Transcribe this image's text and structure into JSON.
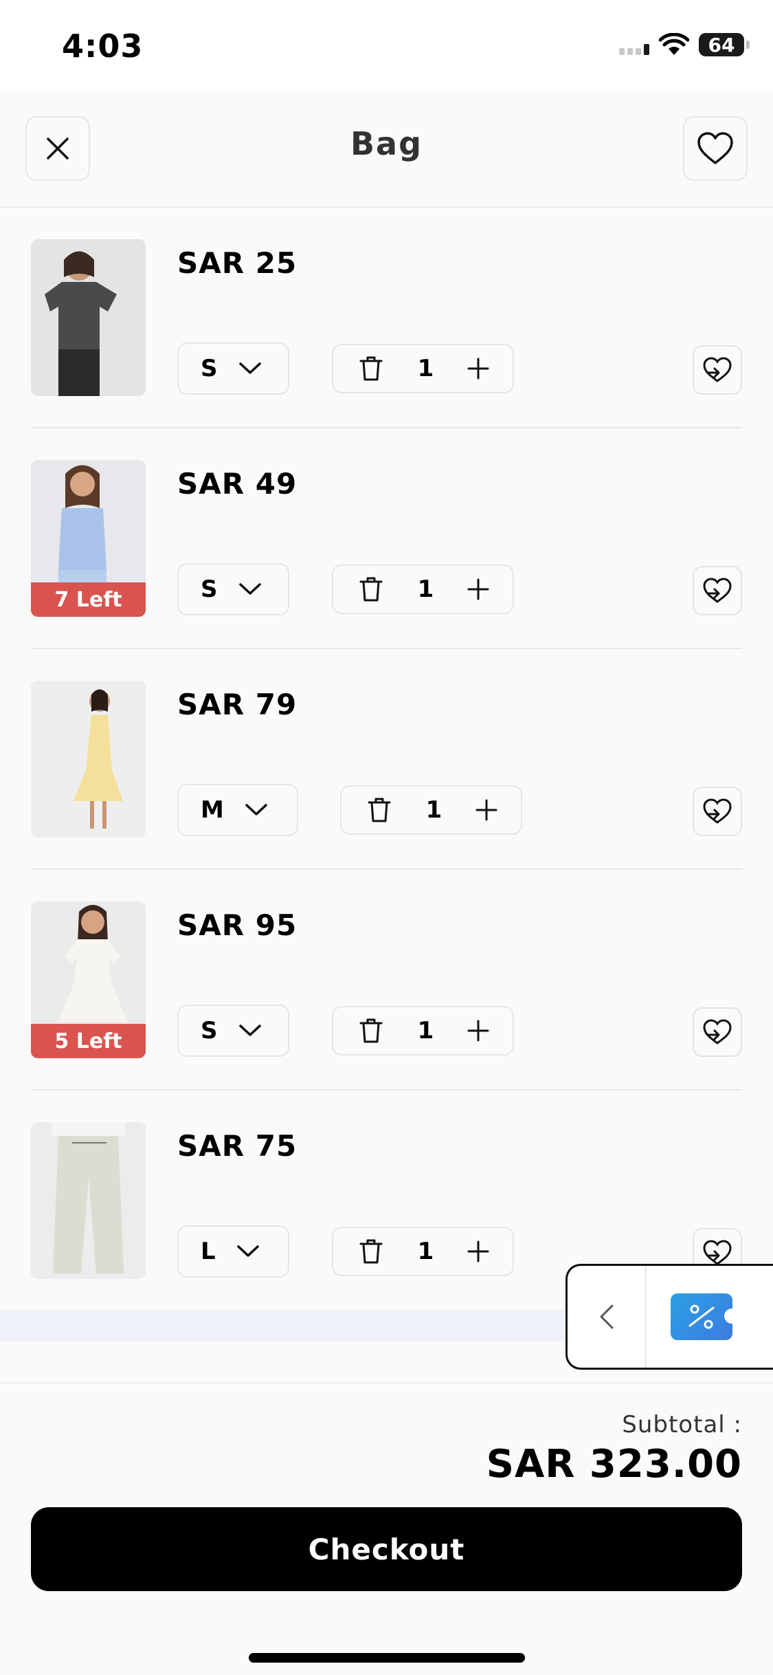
{
  "status_bar": {
    "time": "4:03",
    "battery": "64"
  },
  "header": {
    "title": "Bag",
    "close_icon": "close-icon",
    "wishlist_icon": "heart-icon"
  },
  "items": [
    {
      "price": "SAR 25",
      "size": "S",
      "quantity": "1",
      "badge": "",
      "image": "grey BALANCE t-shirt"
    },
    {
      "price": "SAR 49",
      "size": "S",
      "quantity": "1",
      "badge": "7 Left",
      "image": "blue striped vest"
    },
    {
      "price": "SAR 79",
      "size": "M",
      "quantity": "1",
      "badge": "",
      "image": "yellow gingham dress"
    },
    {
      "price": "SAR 95",
      "size": "S",
      "quantity": "1",
      "badge": "5 Left",
      "image": "white puff-sleeve dress"
    },
    {
      "price": "SAR 75",
      "size": "L",
      "quantity": "1",
      "badge": "",
      "image": "striped wide-leg trousers"
    }
  ],
  "footer": {
    "subtotal_label": "Subtotal :",
    "subtotal_value": "SAR 323.00",
    "checkout_label": "Checkout"
  },
  "colors": {
    "badge": "#d9534f",
    "coupon": "#2aa1e6",
    "checkout": "#000000"
  }
}
